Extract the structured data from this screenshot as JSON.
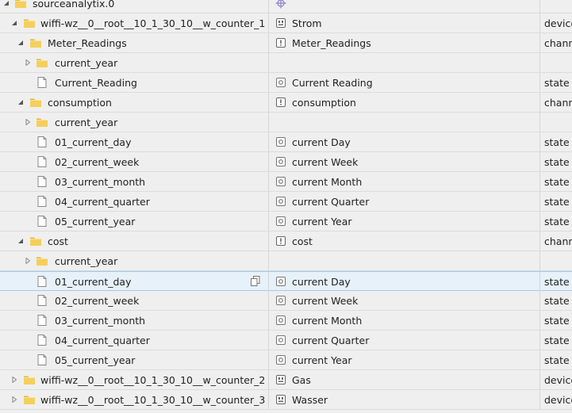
{
  "rows": [
    {
      "id": "sourceanalytix.0",
      "name": "",
      "type": "",
      "depth": 0,
      "caret": "expanded",
      "icon": "folder",
      "name_icon": "adapter"
    },
    {
      "id": "wiffi-wz__0__root__10_1_30_10__w_counter_1",
      "name": "Strom",
      "type": "device",
      "depth": 1,
      "caret": "expanded",
      "icon": "folder",
      "name_icon": "device"
    },
    {
      "id": "Meter_Readings",
      "name": "Meter_Readings",
      "type": "channel",
      "depth": 2,
      "caret": "expanded",
      "icon": "folder",
      "name_icon": "channel"
    },
    {
      "id": "current_year",
      "name": "",
      "type": "",
      "depth": 3,
      "caret": "collapsed",
      "icon": "folder",
      "name_icon": ""
    },
    {
      "id": "Current_Reading",
      "name": "Current Reading",
      "type": "state",
      "depth": 3,
      "caret": "",
      "icon": "file",
      "name_icon": "state"
    },
    {
      "id": "consumption",
      "name": "consumption",
      "type": "channel",
      "depth": 2,
      "caret": "expanded",
      "icon": "folder",
      "name_icon": "channel"
    },
    {
      "id": "current_year",
      "name": "",
      "type": "",
      "depth": 3,
      "caret": "collapsed",
      "icon": "folder",
      "name_icon": ""
    },
    {
      "id": "01_current_day",
      "name": "current Day",
      "type": "state",
      "depth": 3,
      "caret": "",
      "icon": "file",
      "name_icon": "state"
    },
    {
      "id": "02_current_week",
      "name": "current Week",
      "type": "state",
      "depth": 3,
      "caret": "",
      "icon": "file",
      "name_icon": "state"
    },
    {
      "id": "03_current_month",
      "name": "current Month",
      "type": "state",
      "depth": 3,
      "caret": "",
      "icon": "file",
      "name_icon": "state"
    },
    {
      "id": "04_current_quarter",
      "name": "current Quarter",
      "type": "state",
      "depth": 3,
      "caret": "",
      "icon": "file",
      "name_icon": "state"
    },
    {
      "id": "05_current_year",
      "name": "current Year",
      "type": "state",
      "depth": 3,
      "caret": "",
      "icon": "file",
      "name_icon": "state"
    },
    {
      "id": "cost",
      "name": "cost",
      "type": "channel",
      "depth": 2,
      "caret": "expanded",
      "icon": "folder",
      "name_icon": "channel"
    },
    {
      "id": "current_year",
      "name": "",
      "type": "",
      "depth": 3,
      "caret": "collapsed",
      "icon": "folder",
      "name_icon": ""
    },
    {
      "id": "01_current_day",
      "name": "current Day",
      "type": "state",
      "depth": 3,
      "caret": "",
      "icon": "file",
      "name_icon": "state",
      "selected": true
    },
    {
      "id": "02_current_week",
      "name": "current Week",
      "type": "state",
      "depth": 3,
      "caret": "",
      "icon": "file",
      "name_icon": "state"
    },
    {
      "id": "03_current_month",
      "name": "current Month",
      "type": "state",
      "depth": 3,
      "caret": "",
      "icon": "file",
      "name_icon": "state"
    },
    {
      "id": "04_current_quarter",
      "name": "current Quarter",
      "type": "state",
      "depth": 3,
      "caret": "",
      "icon": "file",
      "name_icon": "state"
    },
    {
      "id": "05_current_year",
      "name": "current Year",
      "type": "state",
      "depth": 3,
      "caret": "",
      "icon": "file",
      "name_icon": "state"
    },
    {
      "id": "wiffi-wz__0__root__10_1_30_10__w_counter_2",
      "name": "Gas",
      "type": "device",
      "depth": 1,
      "caret": "collapsed",
      "icon": "folder",
      "name_icon": "device"
    },
    {
      "id": "wiffi-wz__0__root__10_1_30_10__w_counter_3",
      "name": "Wasser",
      "type": "device",
      "depth": 1,
      "caret": "collapsed",
      "icon": "folder",
      "name_icon": "device"
    }
  ],
  "copy_icon": "copy-icon",
  "colors": {
    "selected_bg": "#e6f1f9",
    "selected_border": "#9ecbe8",
    "folder": "#f2c44a",
    "adapter_icon": "#8e7cc3"
  }
}
